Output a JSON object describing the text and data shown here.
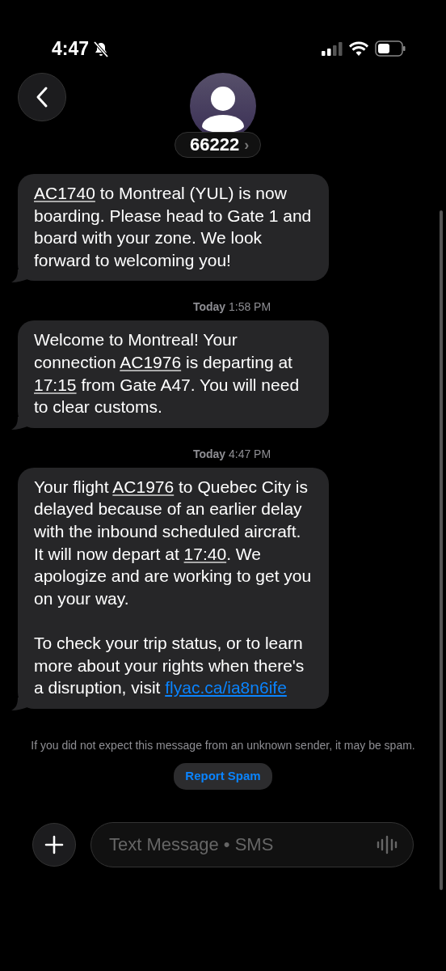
{
  "status_bar": {
    "time": "4:47",
    "silenced": true
  },
  "contact": {
    "name": "66222",
    "chevron": "›"
  },
  "thread": [
    {
      "kind": "message",
      "paragraphs": [
        [
          {
            "kind": "link",
            "text": "AC1740"
          },
          {
            "kind": "text",
            "text": " to Montreal (YUL) is now boarding. Please head to Gate 1 and board with your zone. We look forward to welcoming you!"
          }
        ]
      ]
    },
    {
      "kind": "timestamp",
      "day": "Today",
      "time": "1:58 PM"
    },
    {
      "kind": "message",
      "paragraphs": [
        [
          {
            "kind": "text",
            "text": "Welcome to Montreal! Your connection "
          },
          {
            "kind": "link",
            "text": "AC1976"
          },
          {
            "kind": "text",
            "text": " is departing at "
          },
          {
            "kind": "link",
            "text": "17:15"
          },
          {
            "kind": "text",
            "text": " from Gate A47. You will need to clear customs."
          }
        ]
      ]
    },
    {
      "kind": "timestamp",
      "day": "Today",
      "time": "4:47 PM"
    },
    {
      "kind": "message",
      "paragraphs": [
        [
          {
            "kind": "text",
            "text": "Your flight "
          },
          {
            "kind": "link",
            "text": "AC1976"
          },
          {
            "kind": "text",
            "text": " to Quebec City is delayed because of an earlier delay with the inbound scheduled aircraft. It will now depart at "
          },
          {
            "kind": "link",
            "text": "17:40"
          },
          {
            "kind": "text",
            "text": ". We apologize and are working to get you on your way."
          }
        ],
        [
          {
            "kind": "text",
            "text": "To check your trip status, or to learn more about your rights when there's a disruption, visit "
          },
          {
            "kind": "url",
            "text": "flyac.ca/ia8n6ife"
          }
        ]
      ]
    }
  ],
  "spam_notice": "If you did not expect this message from an unknown sender, it may be spam.",
  "report_button": "Report Spam",
  "composer": {
    "placeholder": "Text Message • SMS"
  }
}
